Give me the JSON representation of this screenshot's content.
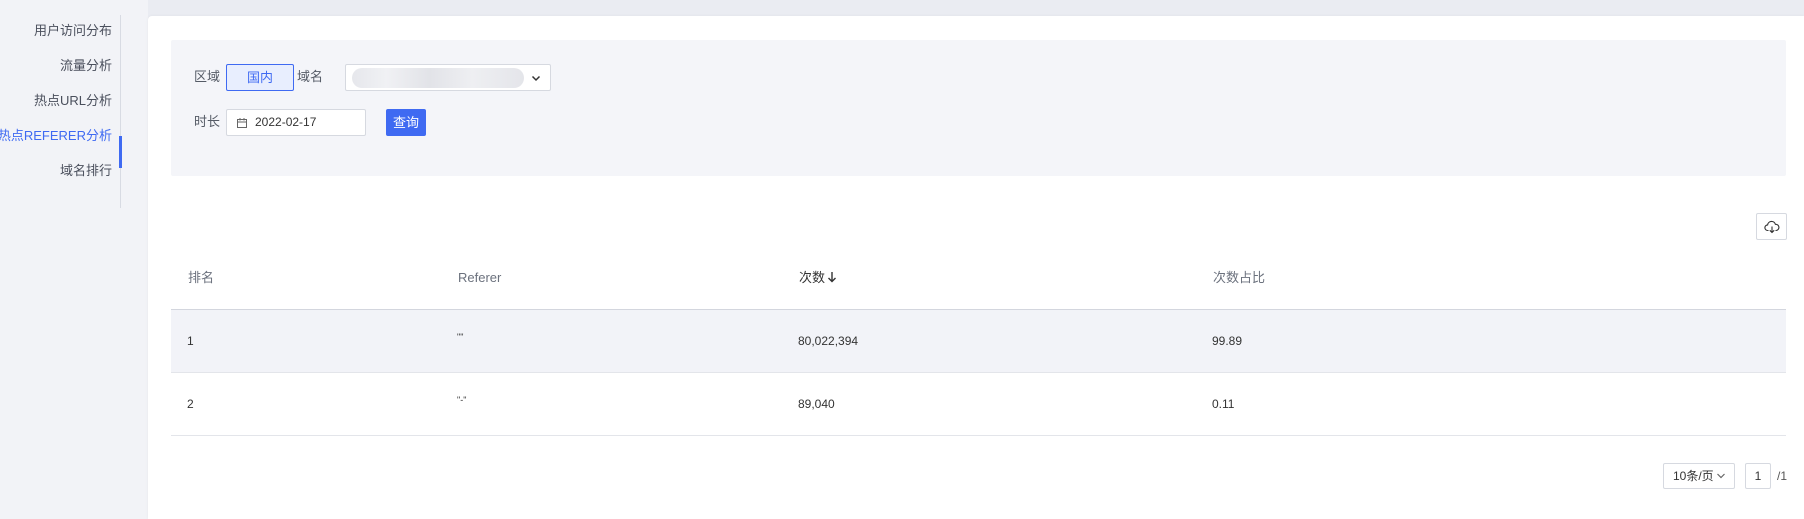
{
  "sidebar": {
    "items": [
      {
        "label": "用户访问分布"
      },
      {
        "label": "流量分析"
      },
      {
        "label": "热点URL分析"
      },
      {
        "label": "热点REFERER分析",
        "active": true
      },
      {
        "label": "域名排行"
      }
    ]
  },
  "filters": {
    "region_label": "区域",
    "region_value": "国内",
    "domain_label": "域名",
    "domain_value": "",
    "duration_label": "时长",
    "date_value": "2022-02-17",
    "query_label": "查询"
  },
  "table": {
    "headers": {
      "rank": "排名",
      "referer": "Referer",
      "count": "次数",
      "ratio": "次数占比"
    },
    "sort": {
      "column": "count",
      "direction": "desc"
    },
    "rows": [
      {
        "rank": "1",
        "referer": "\"\"",
        "count": "80,022,394",
        "ratio": "99.89"
      },
      {
        "rank": "2",
        "referer": "\"-\"",
        "count": "89,040",
        "ratio": "0.11"
      }
    ]
  },
  "pagination": {
    "page_size": "10条/页",
    "current_page": "1",
    "total": "/1"
  },
  "colors": {
    "accent": "#3f6af2",
    "panel": "#f4f5f9",
    "highlight_row": "#f2f3f8"
  },
  "icons": {
    "domain_dropdown": "chevron-down-icon",
    "date": "calendar-icon",
    "download": "cloud-download-icon",
    "sort": "arrow-down-icon"
  }
}
